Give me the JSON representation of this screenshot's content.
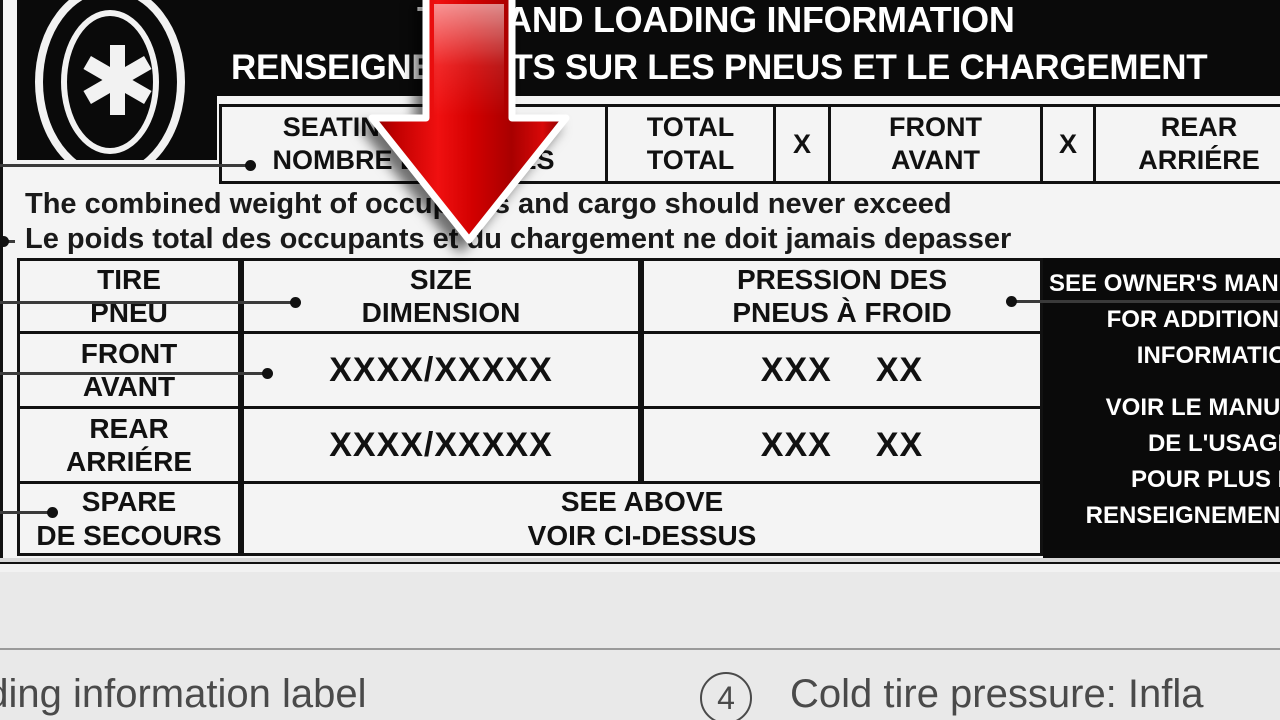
{
  "placard": {
    "header": {
      "line1": "TIRE AND LOADING INFORMATION",
      "line2": "RENSEIGNEMENTS SUR LES PNEUS ET LE CHARGEMENT"
    },
    "tire_icon_name": "tire-wheel-graphic",
    "top_table": {
      "cells": [
        {
          "en": "SEATING CAPACITY",
          "fr": "NOMBRE DE PLACES"
        },
        {
          "en": "TOTAL",
          "fr": "TOTAL"
        },
        {
          "en": "X",
          "fr": ""
        },
        {
          "en": "FRONT",
          "fr": "AVANT"
        },
        {
          "en": "X",
          "fr": ""
        },
        {
          "en": "REAR",
          "fr": "ARRIÉRE"
        }
      ]
    },
    "weight_statement": {
      "en": "The combined weight of occupants and cargo should never exceed",
      "fr": "Le poids total des occupants et du chargement ne doit jamais depasser"
    },
    "main_table": {
      "headers": {
        "tire": {
          "en": "TIRE",
          "fr": "PNEU"
        },
        "size": {
          "en": "SIZE",
          "fr": "DIMENSION"
        },
        "pressure": {
          "en": "PRESSION DES",
          "fr": "PNEUS À FROID"
        }
      },
      "rows": [
        {
          "label_en": "FRONT",
          "label_fr": "AVANT",
          "size": "XXXX/XXXXX",
          "pressure_a": "XXX",
          "pressure_b": "XX"
        },
        {
          "label_en": "REAR",
          "label_fr": "ARRIÉRE",
          "size": "XXXX/XXXXX",
          "pressure_a": "XXX",
          "pressure_b": "XX"
        }
      ],
      "spare": {
        "label_en": "SPARE",
        "label_fr": "DE SECOURS",
        "note_en": "SEE ABOVE",
        "note_fr": "VOIR CI-DESSUS"
      }
    },
    "manual_panel": {
      "line1": "SEE OWNER'S MANUAL",
      "line2": "FOR ADDITIONAL",
      "line3": "INFORMATION.",
      "line4": "VOIR LE MANUEL",
      "line5": "DE L'USAGER",
      "line6": "POUR PLUS DE",
      "line7": "RENSEIGNEMENTS"
    },
    "arrow": {
      "name": "red-down-arrow-pointer",
      "color": "#d40000",
      "direction": "down"
    }
  },
  "caption": {
    "left_text": "ading information label",
    "step_number": "4",
    "right_text": "Cold tire pressure: Infla"
  }
}
